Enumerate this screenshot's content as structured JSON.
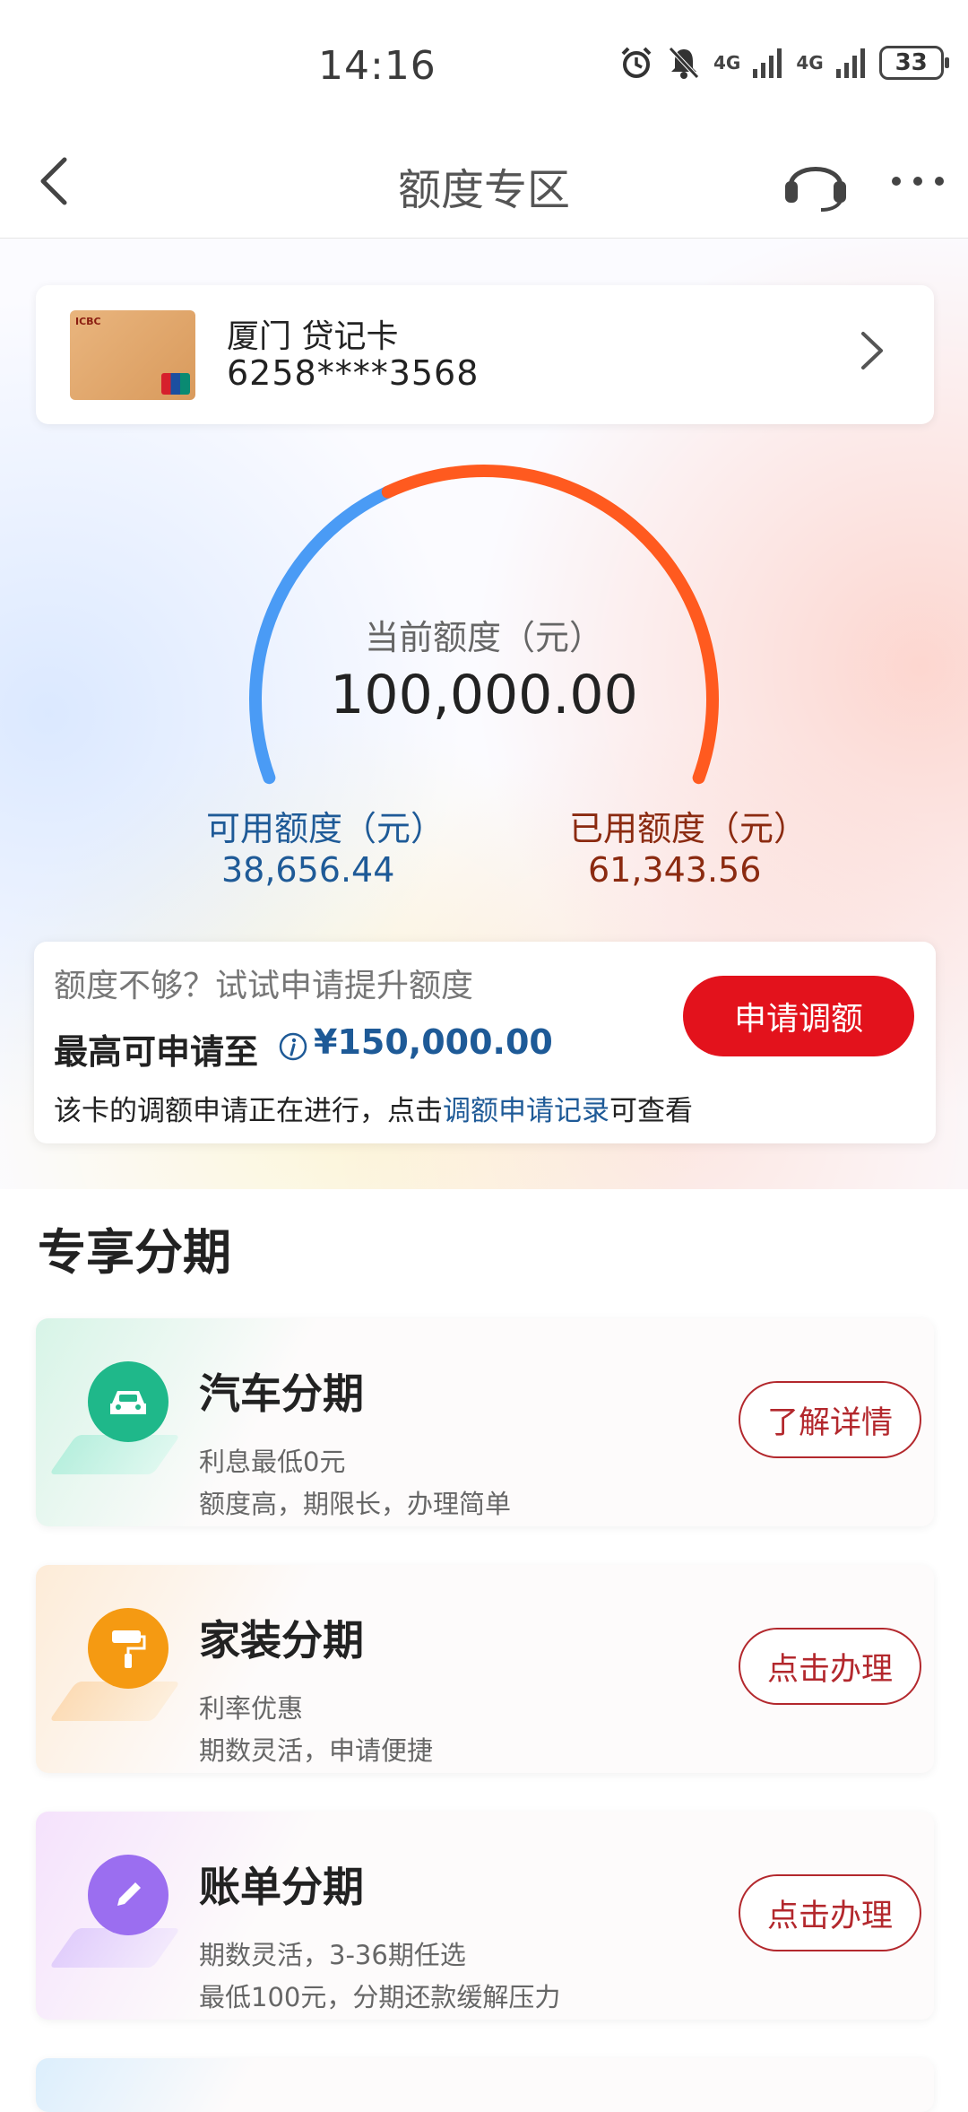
{
  "status_bar": {
    "time": "14:16",
    "network_1": "4G",
    "network_2": "4G",
    "battery": "33"
  },
  "nav": {
    "title": "额度专区"
  },
  "card": {
    "name": "厦门 贷记卡",
    "number": "6258****3568"
  },
  "quota": {
    "current_label": "当前额度（元）",
    "current_value": "100,000.00",
    "available_label": "可用额度（元）",
    "available_value": "38,656.44",
    "used_label": "已用额度（元）",
    "used_value": "61,343.56",
    "used_fraction": 0.613
  },
  "raise": {
    "tip": "额度不够？试试申请提升额度",
    "max_label": "最高可申请至",
    "max_value": "¥150,000.00",
    "note_prefix": "该卡的调额申请正在进行，点击",
    "note_link": "调额申请记录",
    "note_suffix": "可查看",
    "apply_button": "申请调额"
  },
  "section_title": "专享分期",
  "installments": [
    {
      "title": "汽车分期",
      "line1": "利息最低0元",
      "line2": "额度高，期限长，办理简单",
      "button": "了解详情",
      "icon": "car-icon",
      "color": "#1fb88a"
    },
    {
      "title": "家装分期",
      "line1": "利率优惠",
      "line2": "期数灵活，申请便捷",
      "button": "点击办理",
      "icon": "paint-roller-icon",
      "color": "#f59a12"
    },
    {
      "title": "账单分期",
      "line1": "期数灵活，3-36期任选",
      "line2": "最低100元，分期还款缓解压力",
      "button": "点击办理",
      "icon": "pencil-icon",
      "color": "#9b6ef0"
    }
  ],
  "colors": {
    "accent_red": "#e3121c",
    "link_blue": "#1e5a97",
    "gauge_blue": "#4a9bf5",
    "gauge_orange": "#ff5a1f"
  }
}
